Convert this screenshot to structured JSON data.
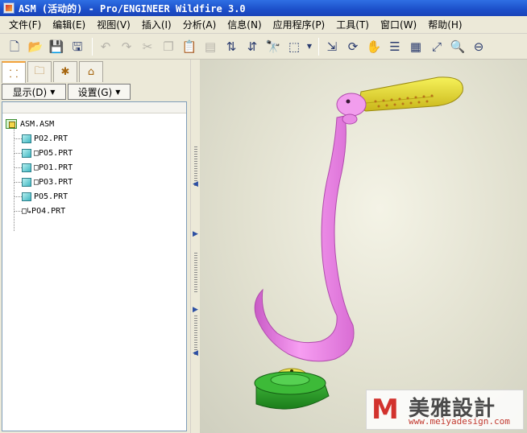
{
  "window": {
    "title": "ASM (活动的) - Pro/ENGINEER Wildfire 3.0"
  },
  "menubar": {
    "items": [
      "文件(F)",
      "编辑(E)",
      "视图(V)",
      "插入(I)",
      "分析(A)",
      "信息(N)",
      "应用程序(P)",
      "工具(T)",
      "窗口(W)",
      "帮助(H)"
    ]
  },
  "toolbar": {
    "buttons": [
      {
        "name": "new-icon",
        "glyph": "🗋"
      },
      {
        "name": "open-icon",
        "glyph": "📂"
      },
      {
        "name": "save-icon",
        "glyph": "💾"
      },
      {
        "name": "save-copy-icon",
        "glyph": "🖫"
      },
      {
        "name": "undo-icon",
        "glyph": "↶",
        "dim": true
      },
      {
        "name": "redo-icon",
        "glyph": "↷",
        "dim": true
      },
      {
        "name": "cut-icon",
        "glyph": "✂",
        "dim": true
      },
      {
        "name": "copy-icon",
        "glyph": "❐",
        "dim": true
      },
      {
        "name": "paste-icon",
        "glyph": "📋",
        "dim": true
      },
      {
        "name": "paste-special-icon",
        "glyph": "▤",
        "dim": true
      },
      {
        "name": "regenerate-icon",
        "glyph": "⇅"
      },
      {
        "name": "regen-manager-icon",
        "glyph": "⇵"
      },
      {
        "name": "find-icon",
        "glyph": "🔭"
      },
      {
        "name": "select-box-icon",
        "glyph": "⬚"
      },
      {
        "name": "datum-display-icon",
        "glyph": "⇲"
      },
      {
        "name": "spin-center-icon",
        "glyph": "⟳"
      },
      {
        "name": "orient-mode-icon",
        "glyph": "✋"
      },
      {
        "name": "layers-icon",
        "glyph": "☰"
      },
      {
        "name": "view-manager-icon",
        "glyph": "▦"
      },
      {
        "name": "refit-icon",
        "glyph": "⤢"
      },
      {
        "name": "zoom-in-icon",
        "glyph": "🔍"
      },
      {
        "name": "zoom-out-icon",
        "glyph": "⊖"
      }
    ]
  },
  "left_panel": {
    "tabs": [
      "model-tree-tab",
      "layer-tree-tab",
      "favorites-tab",
      "connections-tab"
    ],
    "display_button": "显示(D)",
    "settings_button": "设置(G)",
    "tree": {
      "root": "ASM.ASM",
      "items": [
        {
          "label": "PO2.PRT",
          "prefix": ""
        },
        {
          "label": "PO5.PRT",
          "prefix": "□"
        },
        {
          "label": "PO1.PRT",
          "prefix": "□"
        },
        {
          "label": "PO3.PRT",
          "prefix": "□"
        },
        {
          "label": "PO5.PRT",
          "prefix": ""
        },
        {
          "label": "PO4.PRT",
          "prefix": "□↳"
        }
      ]
    }
  },
  "watermark": {
    "logo": "M",
    "name": "美雅設計",
    "url": "www.meiyadesign.com"
  },
  "colors": {
    "titlebar": "#2458d6",
    "hook": "#ee7ee9",
    "head": "#efe93a",
    "base": "#2fa62c"
  }
}
